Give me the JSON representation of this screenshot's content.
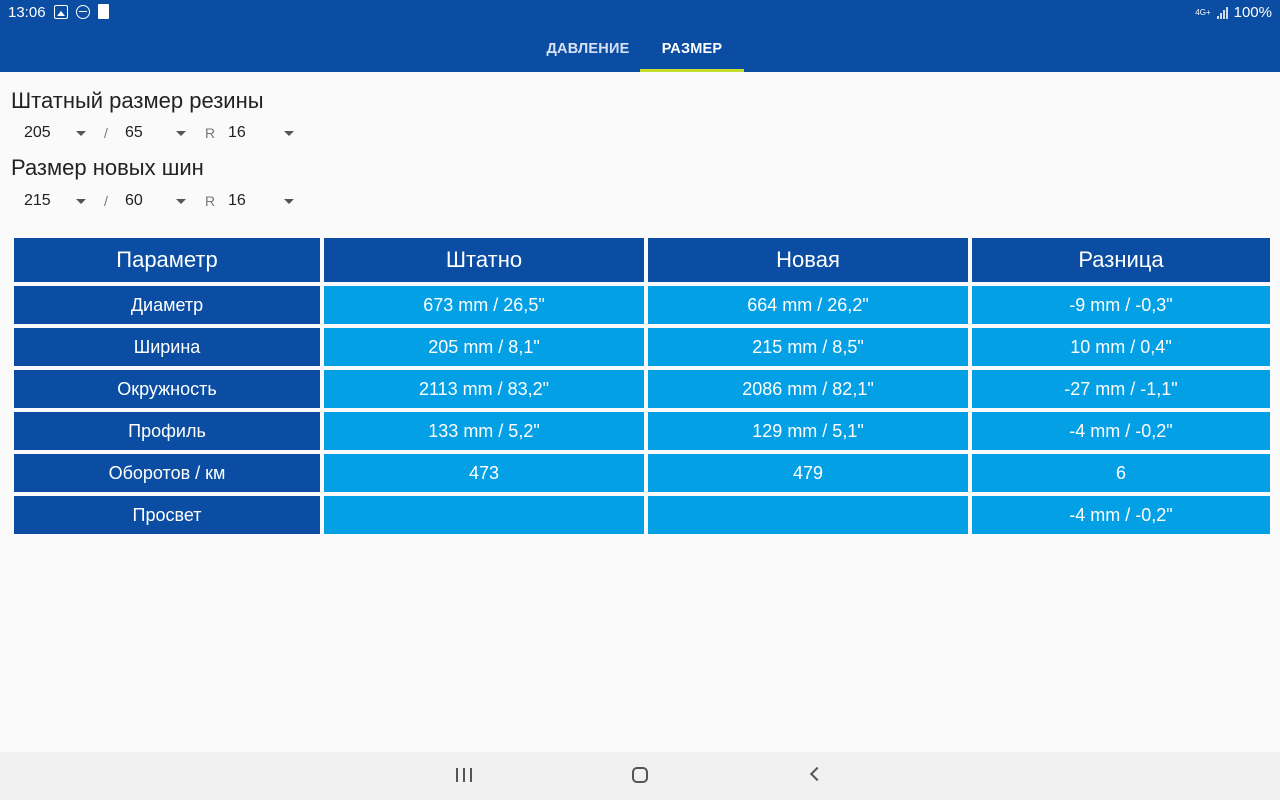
{
  "status_bar": {
    "time": "13:06",
    "network": "4G+",
    "battery": "100%",
    "icons": [
      "image-icon",
      "do-not-disturb-icon",
      "sim-card-icon",
      "signal-icon"
    ]
  },
  "tabs": [
    {
      "label": "ДАВЛЕНИЕ",
      "active": false
    },
    {
      "label": "РАЗМЕР",
      "active": true
    }
  ],
  "stock_size": {
    "title": "Штатный размер резины",
    "width": "205",
    "profile": "65",
    "rim_prefix": "R",
    "rim": "16",
    "separator": "/"
  },
  "new_size": {
    "title": "Размер новых шин",
    "width": "215",
    "profile": "60",
    "rim_prefix": "R",
    "rim": "16",
    "separator": "/"
  },
  "table": {
    "headers": [
      "Параметр",
      "Штатно",
      "Новая",
      "Разница"
    ],
    "rows": [
      [
        "Диаметр",
        "673 mm / 26,5\"",
        "664 mm / 26,2\"",
        "-9 mm / -0,3\""
      ],
      [
        "Ширина",
        "205 mm / 8,1\"",
        "215 mm / 8,5\"",
        "10 mm / 0,4\""
      ],
      [
        "Окружность",
        "2113 mm / 83,2\"",
        "2086 mm / 82,1\"",
        "-27 mm / -1,1\""
      ],
      [
        "Профиль",
        "133 mm / 5,2\"",
        "129 mm / 5,1\"",
        "-4 mm / -0,2\""
      ],
      [
        "Оборотов / км",
        "473",
        "479",
        "6"
      ],
      [
        "Просвет",
        "",
        "",
        "-4 mm / -0,2\""
      ]
    ]
  },
  "colors": {
    "header_blue": "#0a4da2",
    "cell_blue": "#04a0e6",
    "tab_indicator": "#c6dd2e",
    "background": "#fafafa"
  }
}
